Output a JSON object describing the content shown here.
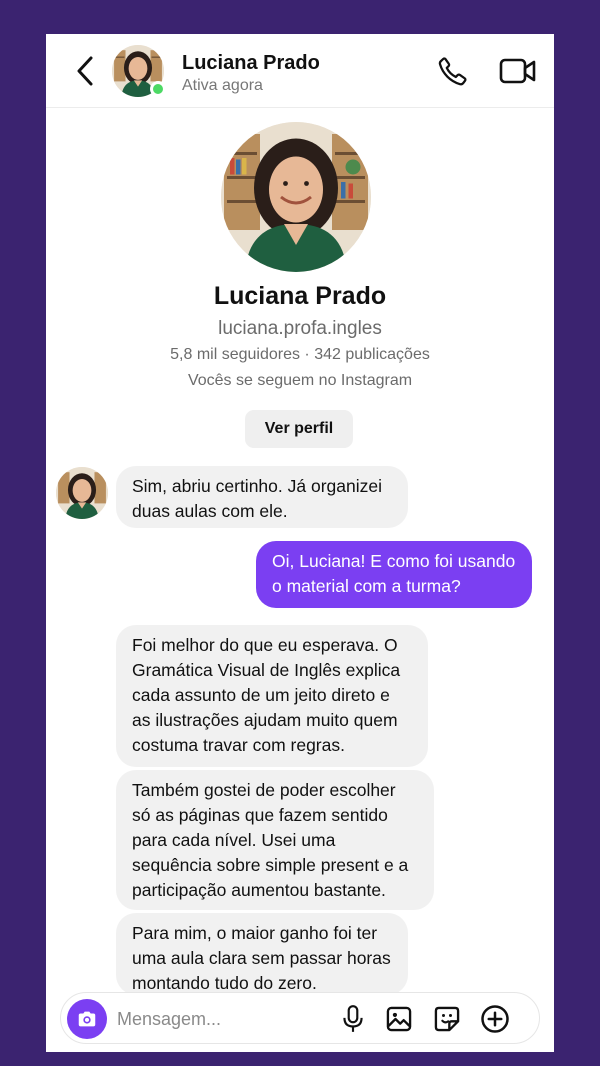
{
  "header": {
    "name": "Luciana Prado",
    "status": "Ativa agora",
    "back_icon": "chevron-left-icon",
    "call_icon": "phone-icon",
    "video_icon": "video-camera-icon"
  },
  "profile": {
    "name": "Luciana Prado",
    "username": "luciana.profa.ingles",
    "stats": "5,8 mil seguidores · 342 publicações",
    "mutual": "Vocês se seguem no Instagram",
    "view_button": "Ver perfil"
  },
  "messages": [
    {
      "from": "contact",
      "text": "Sim, abriu certinho. Já organizei duas aulas com ele."
    },
    {
      "from": "me",
      "text": "Oi, Luciana! E como foi usando o material com a turma?"
    },
    {
      "from": "contact",
      "text": "Foi melhor do que eu esperava. O Gramática Visual de Inglês explica cada assunto de um jeito direto e as ilustrações ajudam muito quem costuma travar com regras."
    },
    {
      "from": "contact",
      "text": "Também gostei de poder escolher só as páginas que fazem sentido para cada nível. Usei uma sequência sobre simple present e a participação aumentou bastante."
    },
    {
      "from": "contact",
      "text": "Para mim, o maior ganho foi ter uma aula clara sem passar horas montando tudo do zero."
    }
  ],
  "composer": {
    "placeholder": "Mensagem...",
    "icons": [
      "camera-icon",
      "microphone-icon",
      "image-icon",
      "sticker-icon",
      "plus-icon"
    ]
  },
  "colors": {
    "background": "#3b2370",
    "accent": "#7b3ff2",
    "online": "#4cd964",
    "incoming_bubble": "#f1f1f1"
  }
}
